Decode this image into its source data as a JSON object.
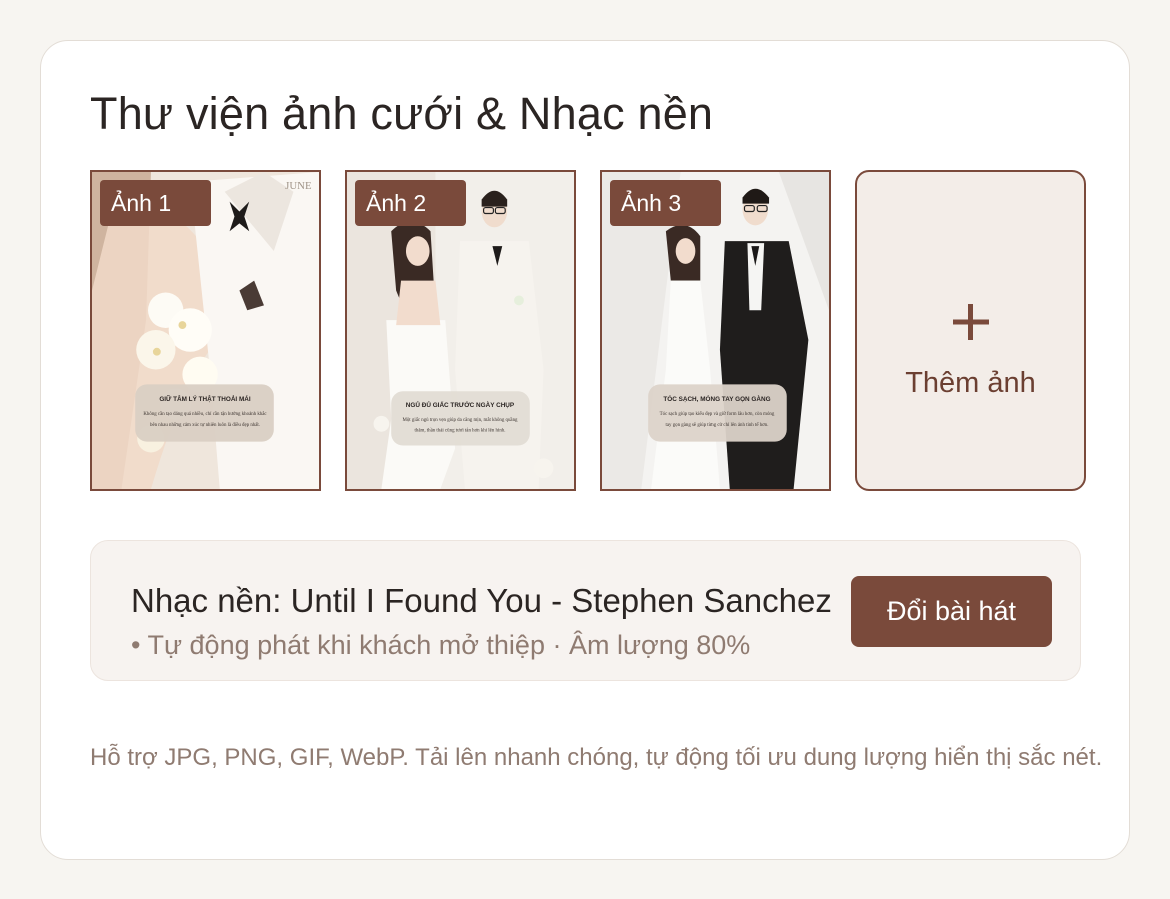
{
  "gallery": {
    "title": "Thư viện ảnh cưới & Nhạc nền",
    "photos": [
      {
        "label": "Ảnh 1",
        "brand": "JUNE",
        "caption_title": "GIỮ TÂM LÝ THẬT THOẢI MÁI",
        "caption_text": "Không cần tạo dáng quá nhiều, chỉ cần tận hưởng khoảnh khắc bên nhau những cảm xúc tự nhiên luôn là điều đẹp nhất."
      },
      {
        "label": "Ảnh 2",
        "caption_title": "NGỦ ĐỦ GIẤC TRƯỚC NGÀY CHỤP",
        "caption_text": "Một giấc ngủ trọn vẹn giúp da căng mịn, mắt không quầng thâm, thần thái cũng tươi tắn hơn khi lên hình."
      },
      {
        "label": "Ảnh 3",
        "caption_title": "TÓC SẠCH, MÓNG TAY GỌN GÀNG",
        "caption_text": "Tóc sạch giúp tạo kiểu đẹp và giữ form lâu hơn, còn móng tay gọn gàng sẽ giúp từng cử chỉ lên ảnh tinh tế hơn."
      }
    ],
    "add_label": "Thêm ảnh",
    "add_icon": "plus-icon"
  },
  "music": {
    "title": "Nhạc nền: Until I Found You - Stephen Sanchez",
    "subtitle": "• Tự động phát khi khách mở thiệp · Âm lượng 80%",
    "change_button": "Đổi bài hát"
  },
  "note": "Hỗ trợ JPG, PNG, GIF, WebP. Tải lên nhanh chóng, tự động tối ưu dung lượng hiển thị sắc nét.",
  "colors": {
    "accent": "#7a4a3b",
    "background": "#f7f5f1",
    "card": "#ffffff",
    "muted_text": "#8f7b71"
  }
}
